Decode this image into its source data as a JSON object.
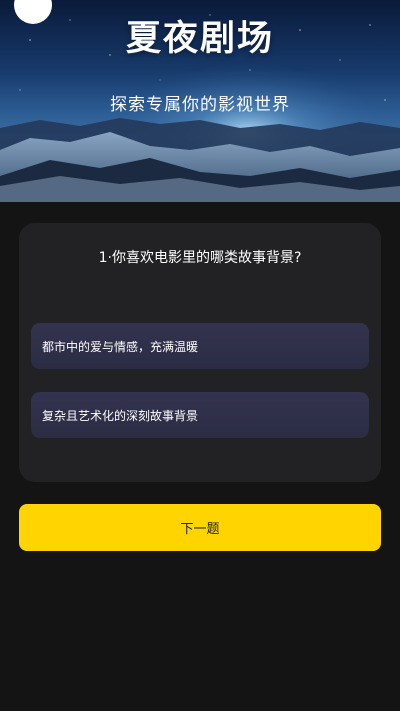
{
  "header": {
    "title": "夏夜剧场",
    "subtitle": "探索专属你的影视世界",
    "back_icon": "chevron-left-icon"
  },
  "quiz": {
    "question": "1·你喜欢电影里的哪类故事背景?",
    "options": [
      {
        "label": "都市中的爱与情感，充满温暖"
      },
      {
        "label": "复杂且艺术化的深刻故事背景"
      }
    ]
  },
  "actions": {
    "next_label": "下一题"
  },
  "colors": {
    "background": "#141414",
    "card": "#222224",
    "option": "#2e2f49",
    "accent": "#ffd400"
  }
}
